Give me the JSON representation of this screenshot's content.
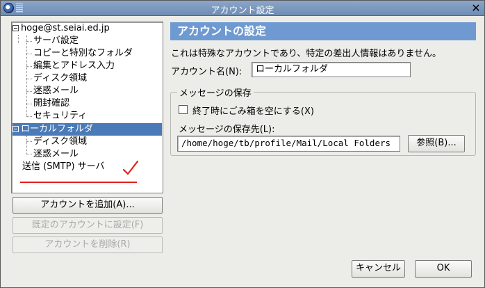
{
  "window": {
    "title": "アカウント設定"
  },
  "tree": {
    "accounts": [
      {
        "label": "hoge@st.seiai.ed.jp",
        "items": [
          "サーバ設定",
          "コピーと特別なフォルダ",
          "編集とアドレス入力",
          "ディスク領域",
          "迷惑メール",
          "開封確認",
          "セキュリティ"
        ]
      },
      {
        "label": "ローカルフォルダ",
        "items": [
          "ディスク領域",
          "迷惑メール"
        ]
      }
    ],
    "smtp": "送信 (SMTP) サーバ"
  },
  "buttons": {
    "add_account": "アカウントを追加(A)...",
    "set_default": "既定のアカウントに設定(F)",
    "remove_account": "アカウントを削除(R)",
    "cancel": "キャンセル",
    "ok": "OK",
    "browse": "参照(B)..."
  },
  "main": {
    "heading": "アカウントの設定",
    "description": "これは特殊なアカウントであり、特定の差出人情報はありません。",
    "account_name_label": "アカウント名(N):",
    "account_name_value": "ローカルフォルダ",
    "message_storage_title": "メッセージの保存",
    "empty_trash_label": "終了時にごみ箱を空にする(X)",
    "empty_trash_checked": false,
    "storage_path_label": "メッセージの保存先(L):",
    "storage_path_value": "/home/hoge/tb/profile/Mail/Local Folders"
  },
  "colors": {
    "title_bar": "#7b97bd",
    "heading": "#6f9ad1",
    "selection": "#4a7ab7",
    "annotation": "#e0201b"
  }
}
